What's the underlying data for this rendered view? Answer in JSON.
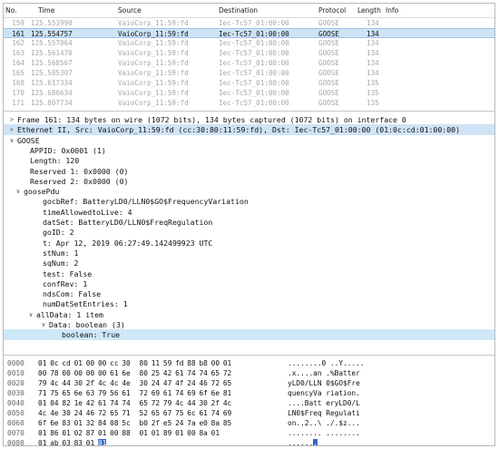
{
  "columns": {
    "no": "No.",
    "time": "Time",
    "source": "Source",
    "destination": "Destination",
    "protocol": "Protocol",
    "length": "Length",
    "info": "Info"
  },
  "packets": [
    {
      "no": "159",
      "time": "125.553990",
      "source": "VaioCorp_11:59:fd",
      "destination": "Iec-Tc57_01:00:00",
      "protocol": "GOOSE",
      "length": "134"
    },
    {
      "no": "161",
      "time": "125.554757",
      "source": "VaioCorp_11:59:fd",
      "destination": "Iec-Tc57_01:00:00",
      "protocol": "GOOSE",
      "length": "134"
    },
    {
      "no": "162",
      "time": "125.557064",
      "source": "VaioCorp_11:59:fd",
      "destination": "Iec-Tc57_01:00:00",
      "protocol": "GOOSE",
      "length": "134"
    },
    {
      "no": "163",
      "time": "125.561470",
      "source": "VaioCorp_11:59:fd",
      "destination": "Iec-Tc57_01:00:00",
      "protocol": "GOOSE",
      "length": "134"
    },
    {
      "no": "164",
      "time": "125.568567",
      "source": "VaioCorp_11:59:fd",
      "destination": "Iec-Tc57_01:00:00",
      "protocol": "GOOSE",
      "length": "134"
    },
    {
      "no": "165",
      "time": "125.585307",
      "source": "VaioCorp_11:59:fd",
      "destination": "Iec-Tc57_01:00:00",
      "protocol": "GOOSE",
      "length": "134"
    },
    {
      "no": "168",
      "time": "125.617334",
      "source": "VaioCorp_11:59:fd",
      "destination": "Iec-Tc57_01:00:00",
      "protocol": "GOOSE",
      "length": "135"
    },
    {
      "no": "170",
      "time": "125.680634",
      "source": "VaioCorp_11:59:fd",
      "destination": "Iec-Tc57_01:00:00",
      "protocol": "GOOSE",
      "length": "135"
    },
    {
      "no": "171",
      "time": "125.807734",
      "source": "VaioCorp_11:59:fd",
      "destination": "Iec-Tc57_01:00:00",
      "protocol": "GOOSE",
      "length": "135"
    }
  ],
  "selected_packet_index": 1,
  "details": [
    {
      "text": "Frame 161: 134 bytes on wire (1072 bits), 134 bytes captured (1072 bits) on interface 0",
      "indent": 0,
      "arrow": ">"
    },
    {
      "text": "Ethernet II, Src: VaioCorp_11:59:fd (cc:30:80:11:59:fd), Dst: Iec-Tc57_01:00:00 (01:0c:cd:01:00:00)",
      "indent": 0,
      "arrow": ">"
    },
    {
      "text": "GOOSE",
      "indent": 0,
      "arrow": "v"
    },
    {
      "text": "APPID: 0x0001 (1)",
      "indent": 2,
      "arrow": ""
    },
    {
      "text": "Length: 120",
      "indent": 2,
      "arrow": ""
    },
    {
      "text": "Reserved 1: 0x0000 (0)",
      "indent": 2,
      "arrow": ""
    },
    {
      "text": "Reserved 2: 0x0000 (0)",
      "indent": 2,
      "arrow": ""
    },
    {
      "text": "goosePdu",
      "indent": 1,
      "arrow": "v"
    },
    {
      "text": "gocbRef: BatteryLD0/LLN0$GO$FrequencyVariation",
      "indent": 4,
      "arrow": ""
    },
    {
      "text": "timeAllowedtoLive: 4",
      "indent": 4,
      "arrow": ""
    },
    {
      "text": "datSet: BatteryLD0/LLN0$FreqRegulation",
      "indent": 4,
      "arrow": ""
    },
    {
      "text": "goID: 2",
      "indent": 4,
      "arrow": ""
    },
    {
      "text": "t: Apr 12, 2019 06:27:49.142499923 UTC",
      "indent": 4,
      "arrow": ""
    },
    {
      "text": "stNum: 1",
      "indent": 4,
      "arrow": ""
    },
    {
      "text": "sqNum: 2",
      "indent": 4,
      "arrow": ""
    },
    {
      "text": "test: False",
      "indent": 4,
      "arrow": ""
    },
    {
      "text": "confRev: 1",
      "indent": 4,
      "arrow": ""
    },
    {
      "text": "ndsCom: False",
      "indent": 4,
      "arrow": ""
    },
    {
      "text": "numDatSetEntries: 1",
      "indent": 4,
      "arrow": ""
    },
    {
      "text": "allData: 1 item",
      "indent": 3,
      "arrow": "v"
    },
    {
      "text": "Data: boolean (3)",
      "indent": 5,
      "arrow": "v"
    },
    {
      "text": "boolean: True",
      "indent": 7,
      "arrow": ""
    }
  ],
  "hex": [
    {
      "off": "0000",
      "bytes": [
        "01",
        "0c",
        "cd",
        "01",
        "00",
        "00",
        "cc",
        "30",
        "80",
        "11",
        "59",
        "fd",
        "88",
        "b8",
        "00",
        "01"
      ],
      "ascii": "........0 ..Y....."
    },
    {
      "off": "0010",
      "bytes": [
        "00",
        "78",
        "00",
        "00",
        "00",
        "00",
        "61",
        "6e",
        "80",
        "25",
        "42",
        "61",
        "74",
        "74",
        "65",
        "72"
      ],
      "ascii": ".x....an .%Batter"
    },
    {
      "off": "0020",
      "bytes": [
        "79",
        "4c",
        "44",
        "30",
        "2f",
        "4c",
        "4c",
        "4e",
        "30",
        "24",
        "47",
        "4f",
        "24",
        "46",
        "72",
        "65"
      ],
      "ascii": "yLD0/LLN 0$GO$Fre"
    },
    {
      "off": "0030",
      "bytes": [
        "71",
        "75",
        "65",
        "6e",
        "63",
        "79",
        "56",
        "61",
        "72",
        "69",
        "61",
        "74",
        "69",
        "6f",
        "6e",
        "81"
      ],
      "ascii": "quencyVa riation."
    },
    {
      "off": "0040",
      "bytes": [
        "01",
        "04",
        "82",
        "1e",
        "42",
        "61",
        "74",
        "74",
        "65",
        "72",
        "79",
        "4c",
        "44",
        "30",
        "2f",
        "4c"
      ],
      "ascii": "....Batt eryLD0/L"
    },
    {
      "off": "0050",
      "bytes": [
        "4c",
        "4e",
        "30",
        "24",
        "46",
        "72",
        "65",
        "71",
        "52",
        "65",
        "67",
        "75",
        "6c",
        "61",
        "74",
        "69"
      ],
      "ascii": "LN0$Freq Regulati"
    },
    {
      "off": "0060",
      "bytes": [
        "6f",
        "6e",
        "83",
        "01",
        "32",
        "84",
        "08",
        "5c",
        "b0",
        "2f",
        "e5",
        "24",
        "7a",
        "e0",
        "8a",
        "85"
      ],
      "ascii": "on..2..\\ ./.$z..."
    },
    {
      "off": "0070",
      "bytes": [
        "01",
        "86",
        "01",
        "02",
        "87",
        "01",
        "00",
        "88",
        "01",
        "01",
        "89",
        "01",
        "00",
        "8a",
        "01"
      ],
      "ascii": "........ ........"
    },
    {
      "off": "0080",
      "bytes": [
        "01",
        "ab",
        "03",
        "83",
        "01",
        "01"
      ],
      "ascii": "......"
    }
  ],
  "hex_selected": {
    "row": 8,
    "byte": 5,
    "ascii_char": "."
  }
}
